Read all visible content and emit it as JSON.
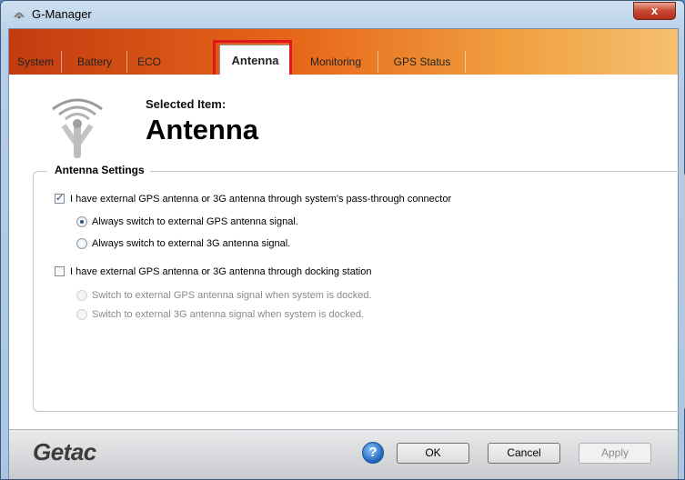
{
  "window": {
    "title": "G-Manager",
    "close_label": "x"
  },
  "tabs": [
    {
      "label": "System",
      "active": false
    },
    {
      "label": "Battery",
      "active": false
    },
    {
      "label": "ECO",
      "active": false
    },
    {
      "label": "Antenna",
      "active": true
    },
    {
      "label": "Monitoring",
      "active": false
    },
    {
      "label": "GPS Status",
      "active": false
    }
  ],
  "header": {
    "selected_label": "Selected Item:",
    "selected_value": "Antenna"
  },
  "settings": {
    "group_title": "Antenna Settings",
    "passthrough": {
      "label": "I have external GPS antenna or 3G antenna through system's pass-through connector",
      "checked": true,
      "options": [
        {
          "label": "Always switch to external GPS antenna signal.",
          "selected": true
        },
        {
          "label": "Always switch to external 3G antenna signal.",
          "selected": false
        }
      ]
    },
    "docking": {
      "label": "I have external GPS antenna or 3G antenna through docking station",
      "checked": false,
      "options": [
        {
          "label": "Switch to external GPS antenna signal when system is docked.",
          "selected": false,
          "disabled": true
        },
        {
          "label": "Switch to external 3G antenna signal when system is docked.",
          "selected": false,
          "disabled": true
        }
      ]
    }
  },
  "footer": {
    "brand": "Getac",
    "help_label": "?",
    "ok_label": "OK",
    "cancel_label": "Cancel",
    "apply_label": "Apply"
  },
  "colors": {
    "tab_accent": "#e86a1a",
    "highlight": "#e3141b"
  }
}
